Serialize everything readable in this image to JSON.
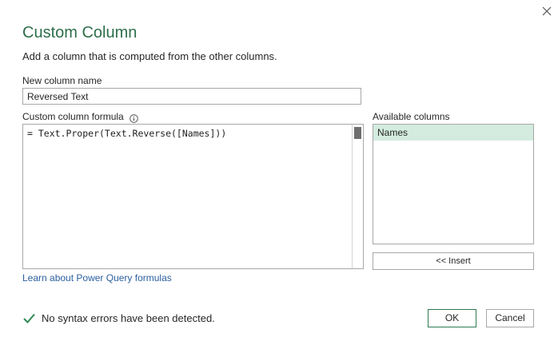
{
  "dialog": {
    "title": "Custom Column",
    "description": "Add a column that is computed from the other columns.",
    "close_icon": "close-icon"
  },
  "new_column": {
    "label": "New column name",
    "value": "Reversed Text"
  },
  "formula": {
    "label": "Custom column formula",
    "info_icon": "info-icon",
    "value": "= Text.Proper(Text.Reverse([Names]))"
  },
  "available_columns": {
    "label": "Available columns",
    "items": [
      "Names"
    ],
    "selected": "Names",
    "insert_label": "<< Insert",
    "selected_color": "#d3ecdf"
  },
  "learn_link": "Learn about Power Query formulas",
  "status": {
    "icon": "check-icon",
    "text": "No syntax errors have been detected."
  },
  "buttons": {
    "ok": "OK",
    "cancel": "Cancel"
  },
  "colors": {
    "title": "#2d6e4a",
    "link": "#2a5f9e",
    "check": "#2f8a57",
    "ok_border": "#2f7a52"
  }
}
